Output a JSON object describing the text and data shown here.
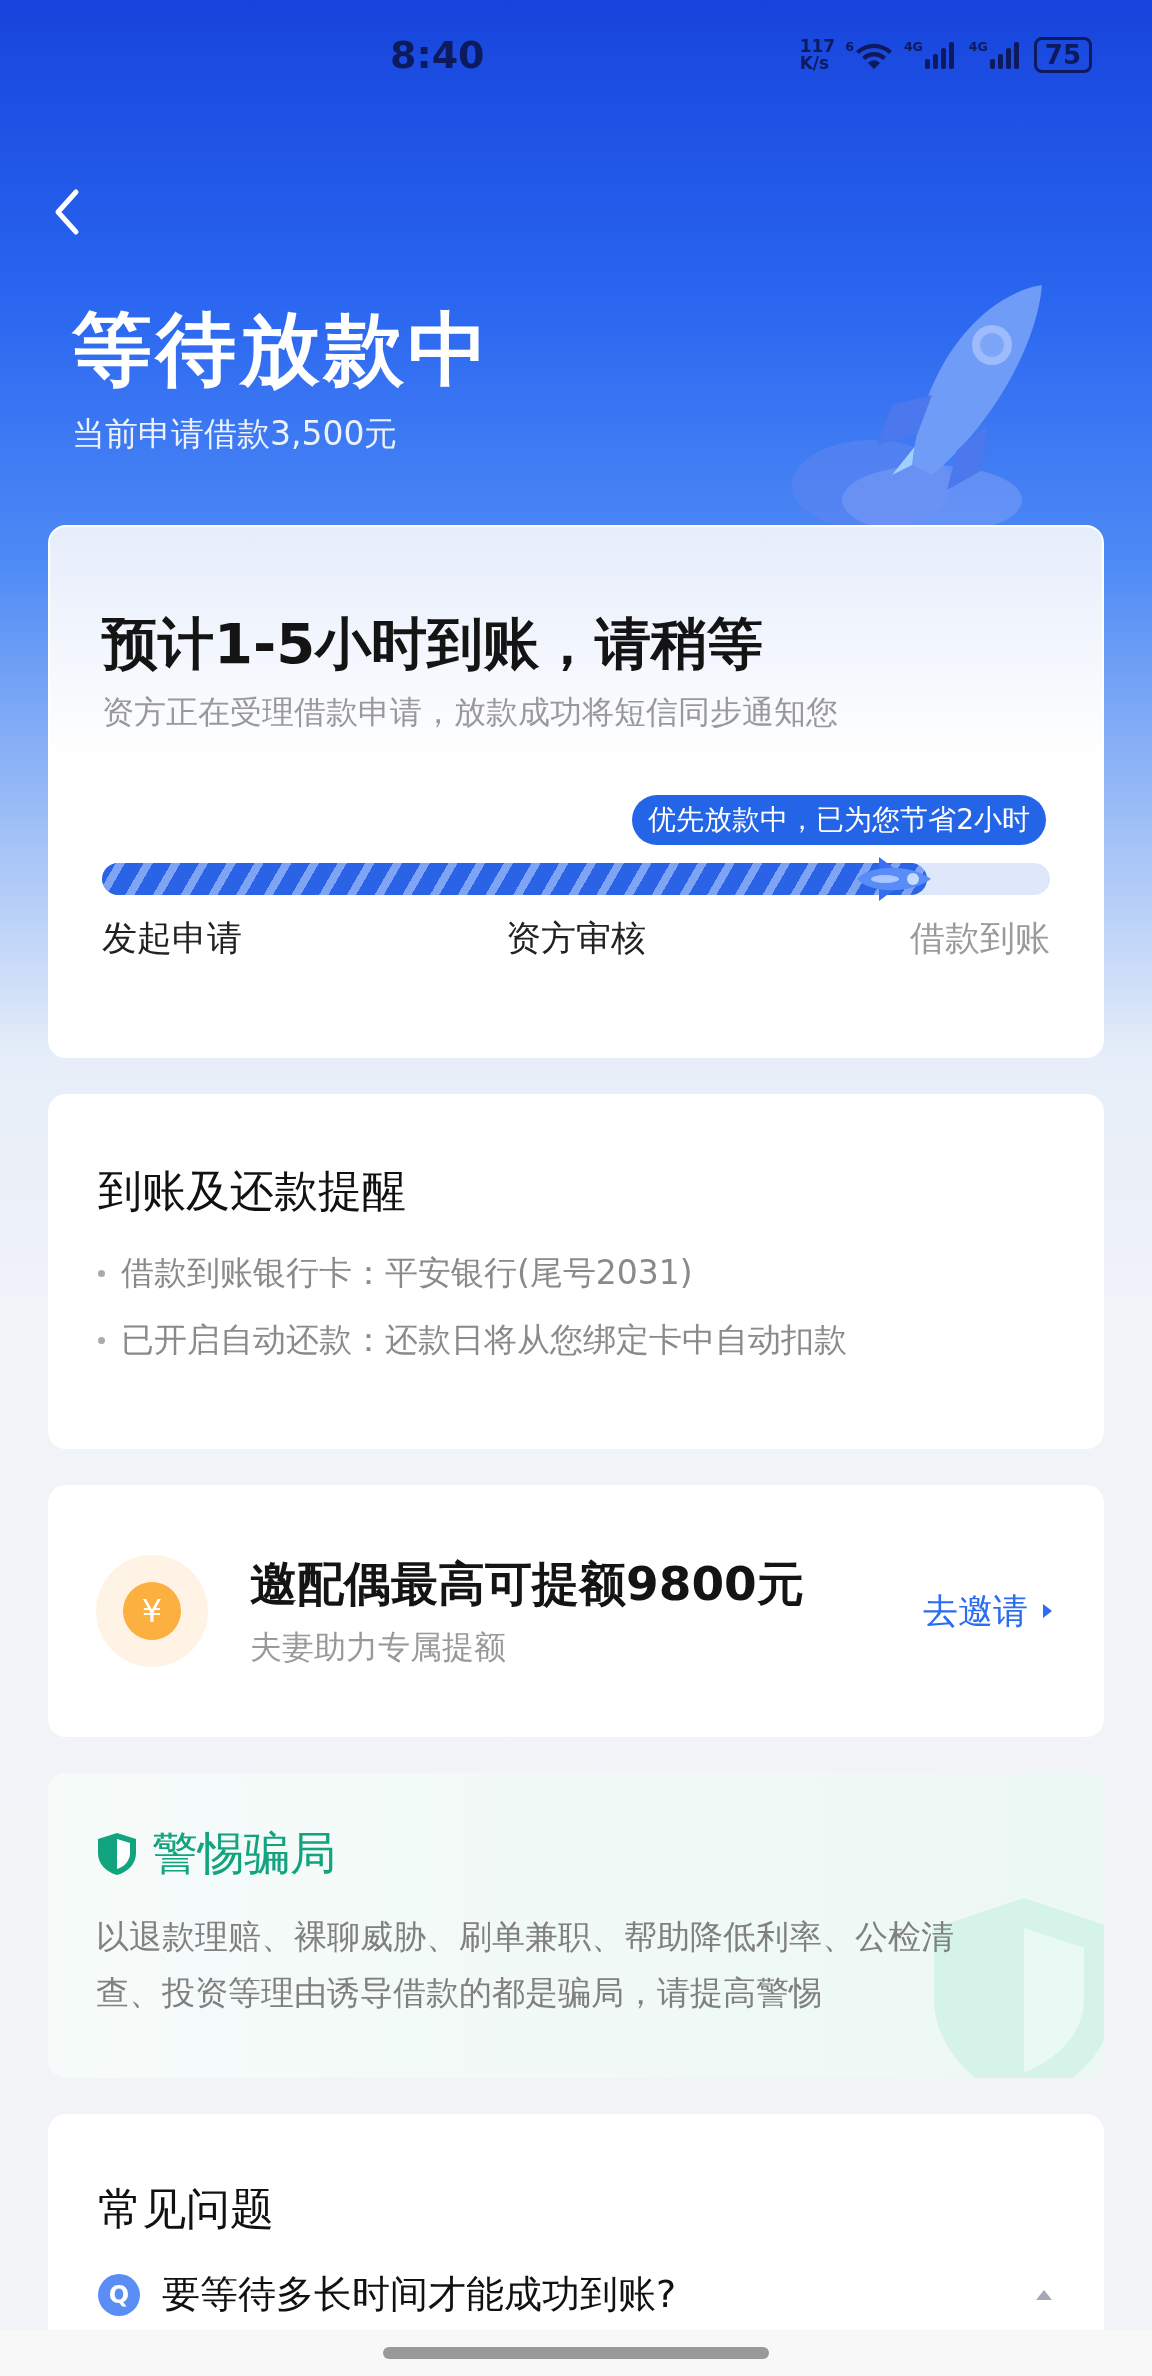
{
  "status_bar": {
    "time": "8:40",
    "net_speed": [
      "117",
      "K/s"
    ],
    "wifi_label": "6",
    "sim_labels": [
      "4G",
      "4G"
    ],
    "battery": "75"
  },
  "header": {
    "title": "等待放款中",
    "subtitle": "当前申请借款3,500元"
  },
  "progress_card": {
    "title": "预计1-5小时到账，请稍等",
    "description": "资方正在受理借款申请，放款成功将短信同步通知您",
    "tooltip": "优先放款中，已为您节省2小时",
    "level": 0.87,
    "steps": [
      {
        "label": "发起申请",
        "reached": true
      },
      {
        "label": "资方审核",
        "reached": true
      },
      {
        "label": "借款到账",
        "reached": false
      }
    ]
  },
  "reminder": {
    "title": "到账及还款提醒",
    "items": [
      "借款到账银行卡：平安银行(尾号2031)",
      "已开启自动还款：还款日将从您绑定卡中自动扣款"
    ]
  },
  "invite": {
    "icon_text": "¥",
    "title": "邀配偶最高可提额9800元",
    "subtitle": "夫妻助力专属提额",
    "link": "去邀请"
  },
  "warning": {
    "title": "警惕骗局",
    "text": "以退款理赔、裸聊威胁、刷单兼职、帮助降低利率、公检清查、投资等理由诱导借款的都是骗局，请提高警惕"
  },
  "faq": {
    "title": "常见问题",
    "questions": [
      {
        "badge": "Q",
        "text": "要等待多长时间才能成功到账?",
        "expanded": true
      }
    ]
  }
}
